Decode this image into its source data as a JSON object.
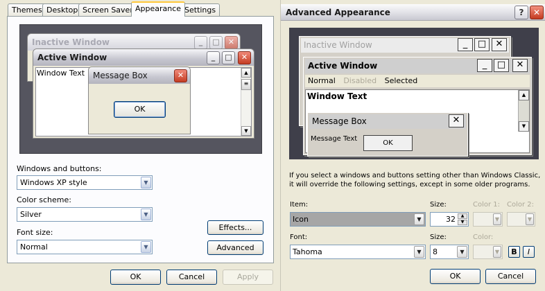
{
  "display_properties": {
    "tabs": [
      {
        "label": "Themes"
      },
      {
        "label": "Desktop"
      },
      {
        "label": "Screen Saver"
      },
      {
        "label": "Appearance"
      },
      {
        "label": "Settings"
      }
    ],
    "active_tab": "Appearance",
    "preview": {
      "inactive_window_title": "Inactive Window",
      "active_window_title": "Active Window",
      "window_text": "Window Text",
      "message_box_title": "Message Box",
      "ok_label": "OK"
    },
    "windows_and_buttons_label": "Windows and buttons:",
    "windows_and_buttons_value": "Windows XP style",
    "color_scheme_label": "Color scheme:",
    "color_scheme_value": "Silver",
    "font_size_label": "Font size:",
    "font_size_value": "Normal",
    "effects_button": "Effects...",
    "advanced_button": "Advanced",
    "ok_button": "OK",
    "cancel_button": "Cancel",
    "apply_button": "Apply"
  },
  "advanced_appearance": {
    "title": "Advanced Appearance",
    "help_label": "?",
    "close_label": "✕",
    "preview": {
      "inactive_window_title": "Inactive Window",
      "active_window_title": "Active Window",
      "menu_normal": "Normal",
      "menu_disabled": "Disabled",
      "menu_selected": "Selected",
      "window_text": "Window Text",
      "message_box_title": "Message Box",
      "message_text": "Message Text",
      "ok_label": "OK"
    },
    "info_text_line1": "If you select a windows and buttons setting other than Windows Classic,",
    "info_text_line2": "it will override the following settings, except in some older programs.",
    "item_label": "Item:",
    "item_value": "Icon",
    "size_label": "Size:",
    "size_value": "32",
    "color1_label": "Color 1:",
    "color2_label": "Color 2:",
    "font_label": "Font:",
    "font_value": "Tahoma",
    "font_size_label": "Size:",
    "font_size_value": "8",
    "font_color_label": "Color:",
    "bold_label": "B",
    "italic_label": "I",
    "ok_button": "OK",
    "cancel_button": "Cancel"
  }
}
